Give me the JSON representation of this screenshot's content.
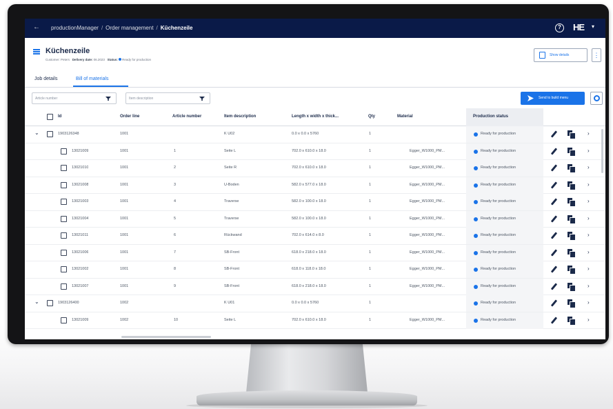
{
  "app": {
    "breadcrumbs": [
      "productionManager",
      "Order management",
      "Küchenzeile"
    ],
    "logo": "HE"
  },
  "header": {
    "title": "Küchenzeile",
    "meta": {
      "customer_label": "Customer:",
      "customer_value": "Peters",
      "delivery_label": "Delivery date:",
      "delivery_value": "06.2023",
      "status_label": "Status:",
      "status_value": "Ready for production"
    },
    "action_label": "Show details",
    "more_label": "⋮"
  },
  "tabs": [
    {
      "label": "Job details"
    },
    {
      "label": "Bill of materials",
      "active": true
    }
  ],
  "filters": {
    "article_placeholder": "Article number",
    "desc_placeholder": "Item description"
  },
  "toolbar": {
    "primary_label": "Send to build menu"
  },
  "table": {
    "columns": {
      "id": "Id",
      "order_line": "Order line",
      "article": "Article number",
      "description": "Item description",
      "dims": "Length x width x thick...",
      "qty": "Qty",
      "material": "Material",
      "status": "Production status"
    },
    "rows": [
      {
        "group": true,
        "id": "1903126348",
        "order_line": "1001",
        "article": "",
        "description": "K U02",
        "dims": "0.0 x 0.0 x 5760",
        "qty": "1",
        "material": "",
        "status": "Ready for production"
      },
      {
        "group": false,
        "id": "13021009",
        "order_line": "1001",
        "article": "1",
        "description": "Seite L",
        "dims": "702.0 x 610.0 x 18.0",
        "qty": "1",
        "material": "Egger_W1000_PM...",
        "status": "Ready for production"
      },
      {
        "group": false,
        "id": "13021010",
        "order_line": "1001",
        "article": "2",
        "description": "Seite R",
        "dims": "702.0 x 610.0 x 18.0",
        "qty": "1",
        "material": "Egger_W1000_PM...",
        "status": "Ready for production"
      },
      {
        "group": false,
        "id": "13021008",
        "order_line": "1001",
        "article": "3",
        "description": "U-Boden",
        "dims": "582.0 x 577.0 x 18.0",
        "qty": "1",
        "material": "Egger_W1000_PM...",
        "status": "Ready for production"
      },
      {
        "group": false,
        "id": "13021003",
        "order_line": "1001",
        "article": "4",
        "description": "Traverse",
        "dims": "582.0 x 100.0 x 18.0",
        "qty": "1",
        "material": "Egger_W1000_PM...",
        "status": "Ready for production"
      },
      {
        "group": false,
        "id": "13021004",
        "order_line": "1001",
        "article": "5",
        "description": "Traverse",
        "dims": "582.0 x 100.0 x 18.0",
        "qty": "1",
        "material": "Egger_W1000_PM...",
        "status": "Ready for production"
      },
      {
        "group": false,
        "id": "13021011",
        "order_line": "1001",
        "article": "6",
        "description": "Rückwand",
        "dims": "702.0 x 614.0 x 8.0",
        "qty": "1",
        "material": "Egger_W1000_PM...",
        "status": "Ready for production"
      },
      {
        "group": false,
        "id": "13021006",
        "order_line": "1001",
        "article": "7",
        "description": "SB-Front",
        "dims": "618.0 x 218.0 x 18.0",
        "qty": "1",
        "material": "Egger_W1000_PM...",
        "status": "Ready for production"
      },
      {
        "group": false,
        "id": "13021002",
        "order_line": "1001",
        "article": "8",
        "description": "SB-Front",
        "dims": "618.0 x 118.0 x 18.0",
        "qty": "1",
        "material": "Egger_W1000_PM...",
        "status": "Ready for production"
      },
      {
        "group": false,
        "id": "13021007",
        "order_line": "1001",
        "article": "9",
        "description": "SB-Front",
        "dims": "618.0 x 218.0 x 18.0",
        "qty": "1",
        "material": "Egger_W1000_PM...",
        "status": "Ready for production"
      },
      {
        "group": true,
        "id": "1903126400",
        "order_line": "1002",
        "article": "",
        "description": "K U01",
        "dims": "0.0 x 0.0 x 5760",
        "qty": "1",
        "material": "",
        "status": "Ready for production"
      },
      {
        "group": false,
        "id": "13021009",
        "order_line": "1002",
        "article": "10",
        "description": "Seite L",
        "dims": "702.0 x 610.0 x 18.0",
        "qty": "1",
        "material": "Egger_W1000_PM...",
        "status": "Ready for production"
      }
    ]
  },
  "colors": {
    "topbar": "#0a1a48",
    "accent": "#1a73e8",
    "status_ready": "#1a73e8"
  },
  "icons": [
    "back-arrow-icon",
    "help-icon",
    "menu-icon",
    "document-icon",
    "filter-icon",
    "send-icon",
    "gear-icon",
    "chevron-down-icon",
    "pencil-icon",
    "copy-icon",
    "chevron-right-icon"
  ]
}
